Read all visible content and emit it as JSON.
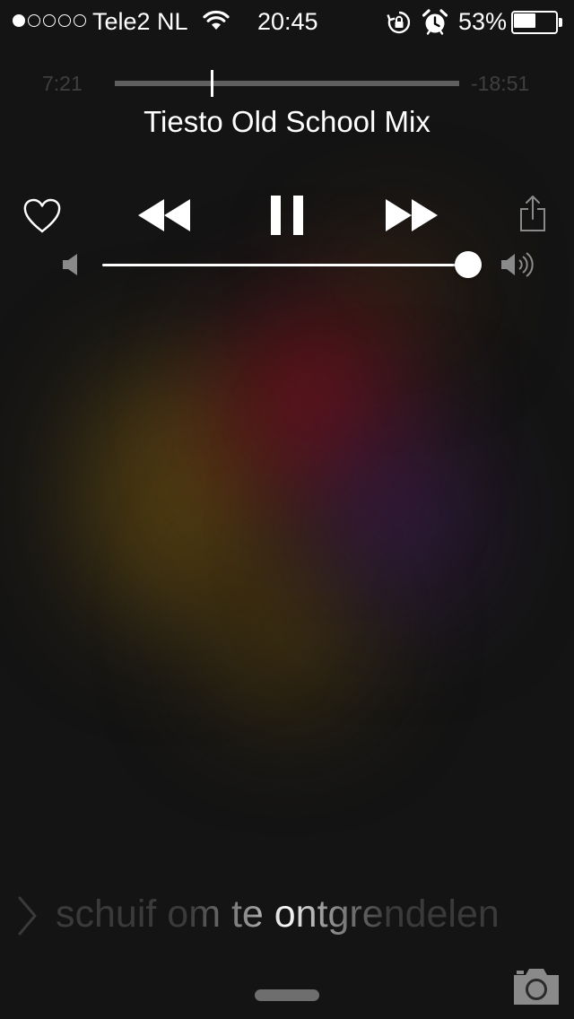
{
  "status_bar": {
    "signal_dots_total": 5,
    "signal_dots_filled": 1,
    "carrier": "Tele2 NL",
    "wifi_icon": "wifi-icon",
    "time": "20:45",
    "rotation_lock_icon": "rotation-lock-icon",
    "alarm_icon": "alarm-icon",
    "battery_percent": "53%",
    "battery_level": 0.53
  },
  "now_playing": {
    "elapsed": "7:21",
    "remaining": "-18:51",
    "progress_fraction": 0.28,
    "title": "Tiesto Old School Mix",
    "volume_fraction": 1.0
  },
  "controls": {
    "love_icon": "heart-icon",
    "rewind_icon": "rewind-icon",
    "pause_icon": "pause-icon",
    "forward_icon": "fast-forward-icon",
    "share_icon": "share-icon",
    "volume_low_icon": "speaker-low-icon",
    "volume_high_icon": "speaker-high-icon"
  },
  "lock_screen": {
    "unlock_text": "schuif om te ontgrendelen",
    "camera_icon": "camera-icon"
  },
  "colors": {
    "background": "#141414",
    "foreground": "#ffffff",
    "dim_text": "#3f3f3f",
    "track": "#5f5f5f"
  }
}
